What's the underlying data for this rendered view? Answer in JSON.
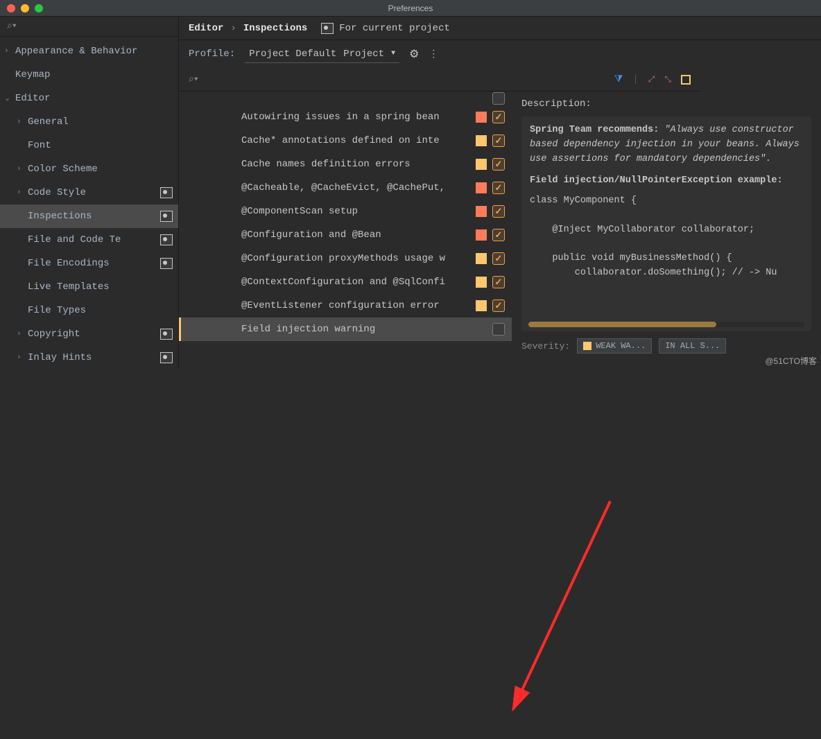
{
  "window": {
    "title": "Preferences"
  },
  "breadcrumb": {
    "a": "Editor",
    "b": "Inspections",
    "for_project": "For current project"
  },
  "profile": {
    "label": "Profile:",
    "name": "Project Default",
    "scope": "Project"
  },
  "sidebar": {
    "items": [
      {
        "label": "Appearance & Behavior",
        "depth": 0,
        "chev": ">",
        "proj": false
      },
      {
        "label": "Keymap",
        "depth": 0,
        "chev": "",
        "proj": false
      },
      {
        "label": "Editor",
        "depth": 0,
        "chev": "v",
        "proj": false
      },
      {
        "label": "General",
        "depth": 1,
        "chev": ">",
        "proj": false
      },
      {
        "label": "Font",
        "depth": 1,
        "chev": "",
        "proj": false
      },
      {
        "label": "Color Scheme",
        "depth": 1,
        "chev": ">",
        "proj": false
      },
      {
        "label": "Code Style",
        "depth": 1,
        "chev": ">",
        "proj": true
      },
      {
        "label": "Inspections",
        "depth": 1,
        "chev": "",
        "proj": true,
        "selected": true
      },
      {
        "label": "File and Code Templates",
        "depth": 1,
        "chev": "",
        "proj": true,
        "trunc": "File and Code Te"
      },
      {
        "label": "File Encodings",
        "depth": 1,
        "chev": "",
        "proj": true
      },
      {
        "label": "Live Templates",
        "depth": 1,
        "chev": "",
        "proj": false
      },
      {
        "label": "File Types",
        "depth": 1,
        "chev": "",
        "proj": false
      },
      {
        "label": "Copyright",
        "depth": 1,
        "chev": ">",
        "proj": true
      },
      {
        "label": "Inlay Hints",
        "depth": 1,
        "chev": ">",
        "proj": true
      }
    ]
  },
  "inspections": [
    {
      "label": "Autowiring issues in a spring bean",
      "sev": "warn",
      "checked": true
    },
    {
      "label": "Cache* annotations defined on interface",
      "sev": "weak",
      "checked": true,
      "trunc": "Cache* annotations defined on inte"
    },
    {
      "label": "Cache names definition errors",
      "sev": "weak",
      "checked": true
    },
    {
      "label": "@Cacheable, @CacheEvict, @CachePut,",
      "sev": "warn",
      "checked": true
    },
    {
      "label": "@ComponentScan setup",
      "sev": "warn",
      "checked": true
    },
    {
      "label": "@Configuration and @Bean",
      "sev": "warn",
      "checked": true
    },
    {
      "label": "@Configuration proxyMethods usage warning",
      "sev": "weak",
      "checked": true,
      "trunc": "@Configuration proxyMethods usage w"
    },
    {
      "label": "@ContextConfiguration and @SqlConfiguration",
      "sev": "weak",
      "checked": true,
      "trunc": "@ContextConfiguration and @SqlConfi"
    },
    {
      "label": "@EventListener configuration error",
      "sev": "weak",
      "checked": true
    },
    {
      "label": "Field injection warning",
      "sev": "",
      "checked": false,
      "selected": true
    }
  ],
  "description": {
    "title": "Description:",
    "recommends_label": "Spring Team recommends:",
    "recommends_quote": "\"Always use constructor based dependency injection in your beans. Always use assertions for mandatory dependencies\".",
    "example_title": "Field injection/NullPointerException example:",
    "code": "class MyComponent {\n\n    @Inject MyCollaborator collaborator;\n\n    public void myBusinessMethod() {\n        collaborator.doSomething(); // -> Nu"
  },
  "severity": {
    "label": "Severity:",
    "value": "WEAK WA...",
    "scope": "IN ALL S..."
  },
  "watermark": "@51CTO博客"
}
